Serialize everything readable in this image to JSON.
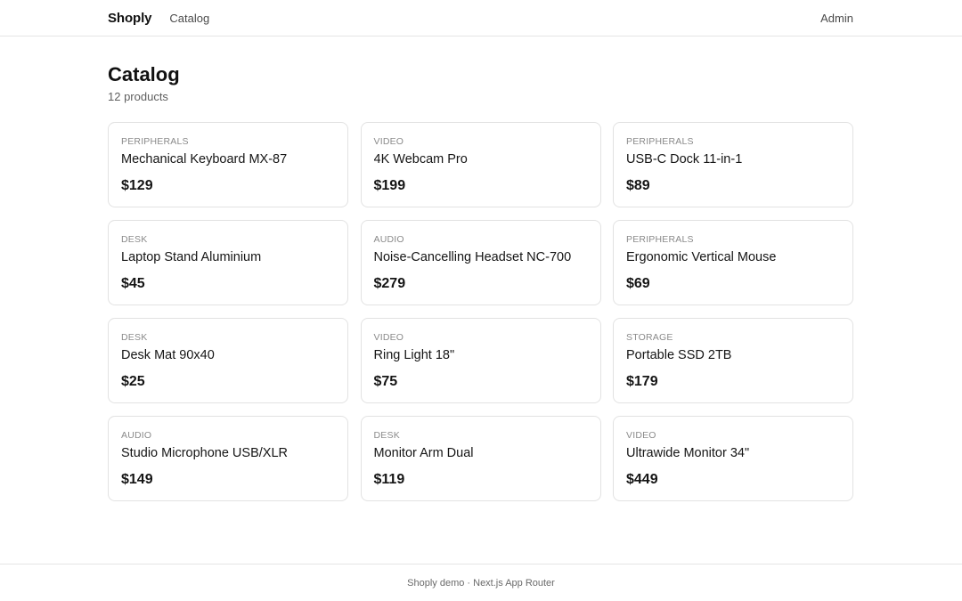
{
  "header": {
    "brand": "Shoply",
    "nav_catalog": "Catalog",
    "admin": "Admin"
  },
  "main": {
    "title": "Catalog",
    "count": "12 products",
    "products": [
      {
        "category": "PERIPHERALS",
        "name": "Mechanical Keyboard MX-87",
        "price": "$129"
      },
      {
        "category": "VIDEO",
        "name": "4K Webcam Pro",
        "price": "$199"
      },
      {
        "category": "PERIPHERALS",
        "name": "USB-C Dock 11-in-1",
        "price": "$89"
      },
      {
        "category": "DESK",
        "name": "Laptop Stand Aluminium",
        "price": "$45"
      },
      {
        "category": "AUDIO",
        "name": "Noise-Cancelling Headset NC-700",
        "price": "$279"
      },
      {
        "category": "PERIPHERALS",
        "name": "Ergonomic Vertical Mouse",
        "price": "$69"
      },
      {
        "category": "DESK",
        "name": "Desk Mat 90x40",
        "price": "$25"
      },
      {
        "category": "VIDEO",
        "name": "Ring Light 18\"",
        "price": "$75"
      },
      {
        "category": "STORAGE",
        "name": "Portable SSD 2TB",
        "price": "$179"
      },
      {
        "category": "AUDIO",
        "name": "Studio Microphone USB/XLR",
        "price": "$149"
      },
      {
        "category": "DESK",
        "name": "Monitor Arm Dual",
        "price": "$119"
      },
      {
        "category": "VIDEO",
        "name": "Ultrawide Monitor 34\"",
        "price": "$449"
      }
    ]
  },
  "footer": {
    "text": "Shoply demo · Next.js App Router"
  }
}
